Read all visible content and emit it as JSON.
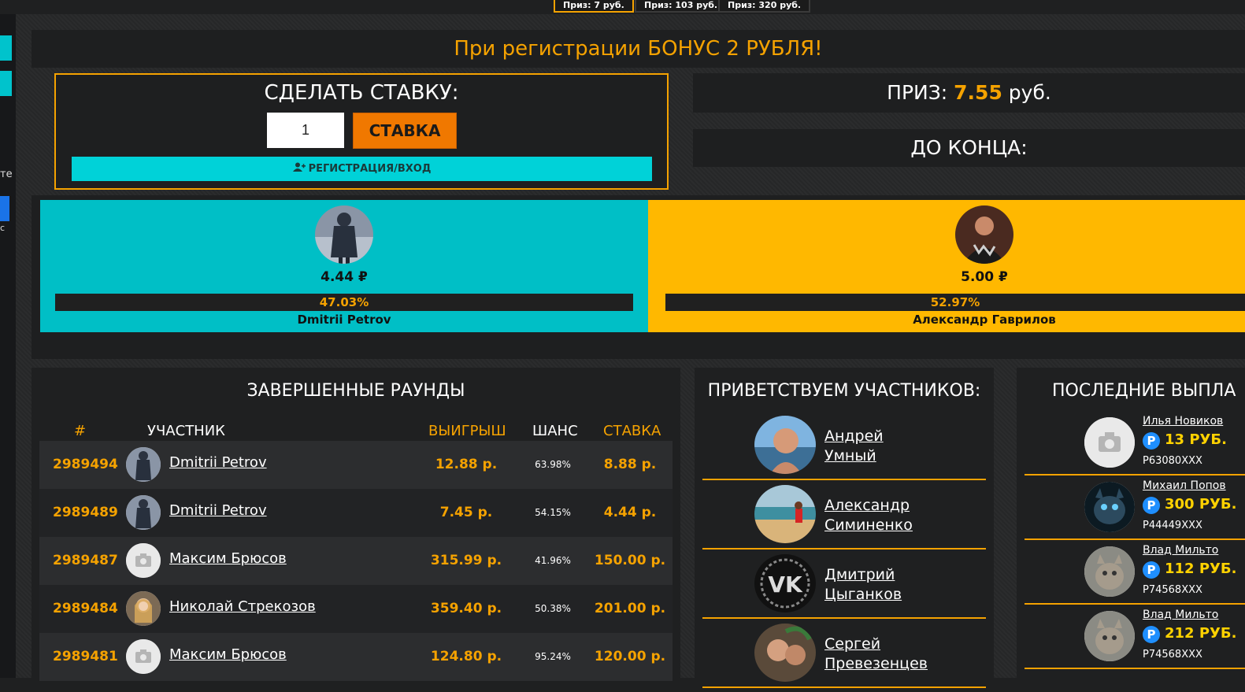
{
  "top_chips": [
    "Приз: 7 руб.",
    "Приз: 103 руб.",
    "Приз: 320 руб."
  ],
  "sidebar": {
    "text1": "те",
    "text2": "с"
  },
  "banner": "При регистрации БОНУС 2 РУБЛЯ!",
  "bet": {
    "title": "СДЕЛАТЬ СТАВКУ:",
    "input_value": "1",
    "button": "СТАВКА",
    "register_button": "РЕГИСТРАЦИЯ/ВХОД"
  },
  "prize": {
    "label": "ПРИЗ:",
    "amount": "7.55",
    "currency": "руб."
  },
  "timer": {
    "label": "ДО КОНЦА:"
  },
  "players": [
    {
      "amount": "4.44 ₽",
      "percent": "47.03%",
      "name": "Dmitrii Petrov",
      "color": "#00bfc6"
    },
    {
      "amount": "5.00 ₽",
      "percent": "52.97%",
      "name": "Александр Гаврилов",
      "color": "#ffb800"
    }
  ],
  "rounds": {
    "title": "ЗАВЕРШЕННЫЕ РАУНДЫ",
    "headers": {
      "id": "#",
      "participant": "УЧАСТНИК",
      "win": "ВЫИГРЫШ",
      "chance": "ШАНС",
      "bet": "СТАВКА"
    },
    "rows": [
      {
        "id": "2989494",
        "name": "Dmitrii Petrov",
        "win": "12.88 р.",
        "chance": "63.98%",
        "bet": "8.88 р.",
        "avatar": "soldier"
      },
      {
        "id": "2989489",
        "name": "Dmitrii Petrov",
        "win": "7.45 р.",
        "chance": "54.15%",
        "bet": "4.44 р.",
        "avatar": "soldier"
      },
      {
        "id": "2989487",
        "name": "Максим Брюсов",
        "win": "315.99 р.",
        "chance": "41.96%",
        "bet": "150.00 р.",
        "avatar": "camera"
      },
      {
        "id": "2989484",
        "name": "Николай Стрекозов",
        "win": "359.40 р.",
        "chance": "50.38%",
        "bet": "201.00 р.",
        "avatar": "girl"
      },
      {
        "id": "2989481",
        "name": "Максим Брюсов",
        "win": "124.80 р.",
        "chance": "95.24%",
        "bet": "120.00 р.",
        "avatar": "camera"
      }
    ]
  },
  "welcome": {
    "title": "ПРИВЕТСТВУЕМ УЧАСТНИКОВ:",
    "items": [
      {
        "line1": "Андрей",
        "line2": "Умный"
      },
      {
        "line1": "Александр",
        "line2": "Симиненко"
      },
      {
        "line1": "Дмитрий",
        "line2": "Цыганков"
      },
      {
        "line1": "Сергей",
        "line2": "Превезенцев"
      }
    ]
  },
  "payouts": {
    "title": "ПОСЛЕДНИЕ ВЫПЛА",
    "items": [
      {
        "name": "Илья Новиков",
        "amount": "13 РУБ.",
        "account": "P63080XXX"
      },
      {
        "name": "Михаил Попов",
        "amount": "300 РУБ.",
        "account": "P44449XXX"
      },
      {
        "name": "Влад Мильто",
        "amount": "112 РУБ.",
        "account": "P74568XXX"
      },
      {
        "name": "Влад Мильто",
        "amount": "212 РУБ.",
        "account": "P74568XXX"
      }
    ],
    "currency_icon": "P"
  }
}
